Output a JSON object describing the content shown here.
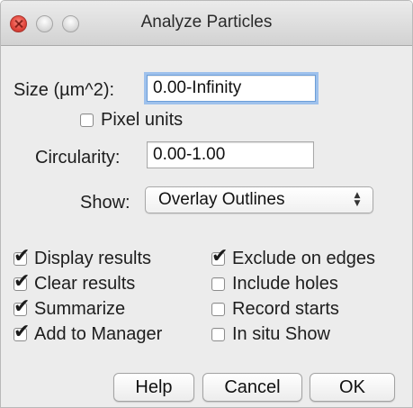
{
  "window": {
    "title": "Analyze Particles"
  },
  "size": {
    "label": "Size (µm^2):",
    "value": "0.00-Infinity"
  },
  "pixel_units": {
    "label": "Pixel units",
    "checked": false
  },
  "circularity": {
    "label": "Circularity:",
    "value": "0.00-1.00"
  },
  "show": {
    "label": "Show:",
    "selected": "Overlay Outlines"
  },
  "options_left": [
    {
      "label": "Display results",
      "checked": true
    },
    {
      "label": "Clear results",
      "checked": true
    },
    {
      "label": "Summarize",
      "checked": true
    },
    {
      "label": "Add to Manager",
      "checked": true
    }
  ],
  "options_right": [
    {
      "label": "Exclude on edges",
      "checked": true
    },
    {
      "label": "Include holes",
      "checked": false
    },
    {
      "label": "Record starts",
      "checked": false
    },
    {
      "label": "In situ Show",
      "checked": false
    }
  ],
  "buttons": {
    "help": "Help",
    "cancel": "Cancel",
    "ok": "OK"
  }
}
